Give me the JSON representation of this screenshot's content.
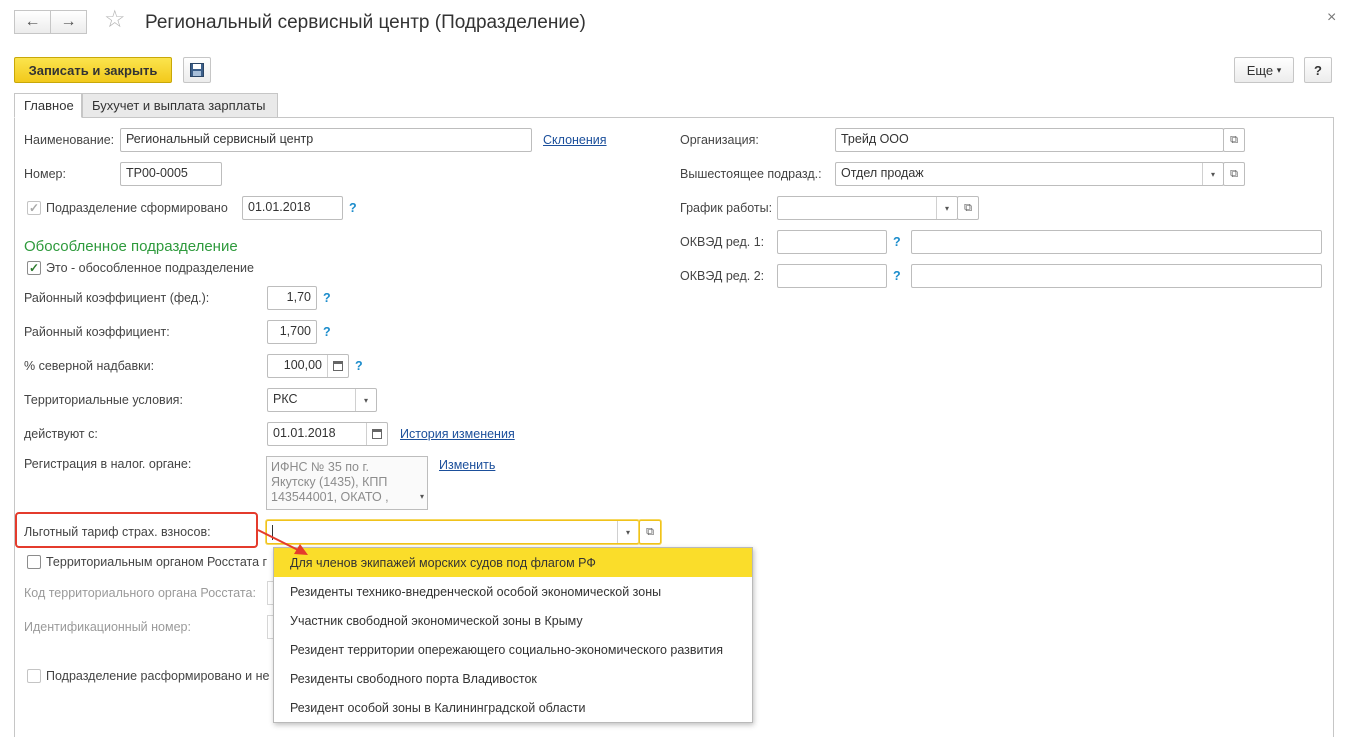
{
  "window": {
    "title": "Региональный сервисный центр (Подразделение)",
    "back_glyph": "←",
    "forward_glyph": "→",
    "favorite_glyph": "☆",
    "close_glyph": "×"
  },
  "toolbar": {
    "save_close_label": "Записать и закрыть",
    "more_label": "Еще",
    "more_arrow": "▾",
    "help_label": "?"
  },
  "tabs": [
    {
      "label": "Главное",
      "active": true
    },
    {
      "label": "Бухучет и выплата зарплаты",
      "active": false
    }
  ],
  "left": {
    "name": {
      "label": "Наименование:",
      "value": "Региональный сервисный центр",
      "link": "Склонения"
    },
    "number": {
      "label": "Номер:",
      "value": "ТР00-0005"
    },
    "formed": {
      "label": "Подразделение сформировано",
      "checked": true,
      "date": "01.01.2018",
      "help": "?"
    },
    "section_title": "Обособленное подразделение",
    "separate": {
      "label": "Это - обособленное подразделение",
      "checked": true
    },
    "fed_coef": {
      "label": "Районный коэффициент (фед.):",
      "value": "1,70",
      "help": "?"
    },
    "coef": {
      "label": "Районный коэффициент:",
      "value": "1,700",
      "help": "?"
    },
    "north": {
      "label": "% северной надбавки:",
      "value": "100,00",
      "help": "?"
    },
    "terr": {
      "label": "Территориальные условия:",
      "value": "РКС"
    },
    "valid_from": {
      "label": "действуют с:",
      "value": "01.01.2018",
      "link": "История изменения"
    },
    "tax_reg": {
      "label": "Регистрация в налог. органе:",
      "lines": [
        "ИФНС № 35 по г.",
        "Якутску (1435), КПП",
        "143544001, ОКАТО ,"
      ],
      "link": "Изменить"
    },
    "tariff": {
      "label": "Льготный тариф страх. взносов:",
      "value": ""
    },
    "rosstat_check": {
      "label": "Территориальным органом Росстата г",
      "checked": false
    },
    "rosstat_code": {
      "label": "Код территориального органа Росстата:"
    },
    "ident": {
      "label": "Идентификационный номер:"
    },
    "disbanded": {
      "label": "Подразделение расформировано и не",
      "checked": false
    }
  },
  "right": {
    "org": {
      "label": "Организация:",
      "value": "Трейд ООО"
    },
    "parent": {
      "label": "Вышестоящее подразд.:",
      "value": "Отдел продаж"
    },
    "schedule": {
      "label": "График работы:",
      "value": ""
    },
    "okved1": {
      "label": "ОКВЭД ред. 1:",
      "help": "?"
    },
    "okved2": {
      "label": "ОКВЭД ред. 2:",
      "help": "?"
    }
  },
  "icons": {
    "dropdown_arrow": "▾",
    "open_glyph": "⧉",
    "check_glyph": "✓"
  },
  "dropdown": {
    "items": [
      "Для членов экипажей морских судов под флагом РФ",
      "Резиденты технико-внедренческой особой экономической зоны",
      "Участник свободной экономической зоны в Крыму",
      "Резидент территории опережающего социально-экономического развития",
      "Резиденты свободного порта Владивосток",
      "Резидент особой зоны в Калининградской области"
    ],
    "selected_index": 0
  },
  "colors": {
    "accent_yellow": "#fadd2a",
    "link_blue": "#1b4f9b",
    "section_green": "#2e9a3c",
    "annotation_red": "#e43b2c"
  }
}
